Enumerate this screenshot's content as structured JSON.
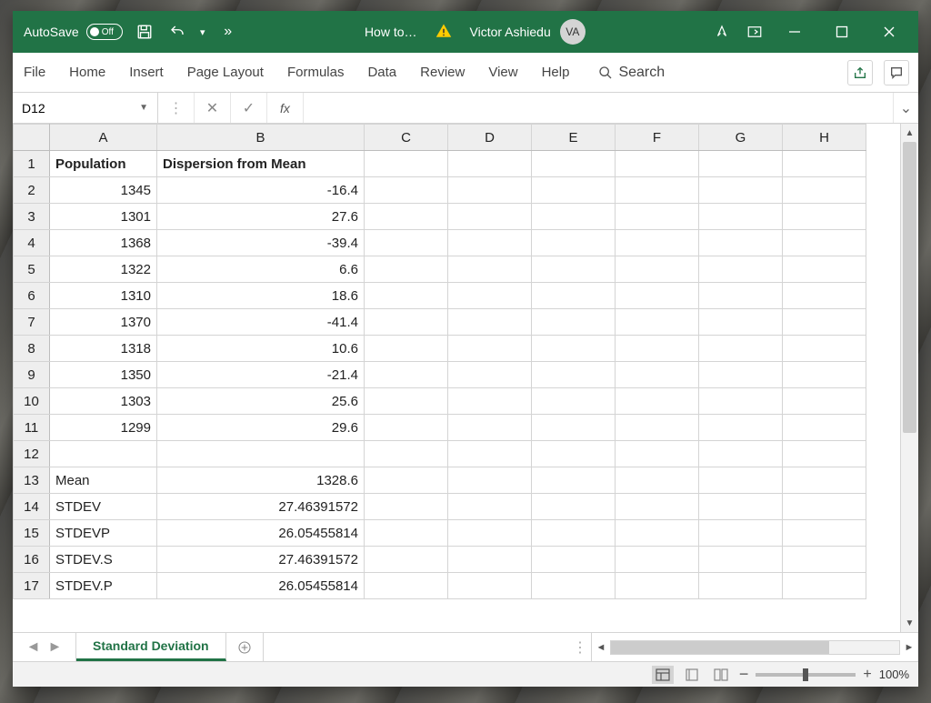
{
  "titlebar": {
    "autosave_label": "AutoSave",
    "autosave_state": "Off",
    "document_title": "How to…",
    "user_name": "Victor Ashiedu",
    "user_initials": "VA"
  },
  "ribbon": {
    "tabs": [
      "File",
      "Home",
      "Insert",
      "Page Layout",
      "Formulas",
      "Data",
      "Review",
      "View",
      "Help"
    ],
    "search_label": "Search"
  },
  "formula_bar": {
    "name_box": "D12",
    "fx_label": "fx",
    "formula": ""
  },
  "columns": [
    "A",
    "B",
    "C",
    "D",
    "E",
    "F",
    "G",
    "H"
  ],
  "col_widths": [
    "col-A",
    "col-B",
    "col-narrow",
    "col-narrow",
    "col-narrow",
    "col-narrow",
    "col-narrow",
    "col-narrow"
  ],
  "rows": [
    {
      "n": 1,
      "A": "Population",
      "A_align": "txt",
      "A_bold": true,
      "B": "Dispersion from Mean",
      "B_align": "txt",
      "B_bold": true
    },
    {
      "n": 2,
      "A": "1345",
      "A_align": "num",
      "B": "-16.4",
      "B_align": "num"
    },
    {
      "n": 3,
      "A": "1301",
      "A_align": "num",
      "B": "27.6",
      "B_align": "num"
    },
    {
      "n": 4,
      "A": "1368",
      "A_align": "num",
      "B": "-39.4",
      "B_align": "num"
    },
    {
      "n": 5,
      "A": "1322",
      "A_align": "num",
      "B": "6.6",
      "B_align": "num"
    },
    {
      "n": 6,
      "A": "1310",
      "A_align": "num",
      "B": "18.6",
      "B_align": "num"
    },
    {
      "n": 7,
      "A": "1370",
      "A_align": "num",
      "B": "-41.4",
      "B_align": "num"
    },
    {
      "n": 8,
      "A": "1318",
      "A_align": "num",
      "B": "10.6",
      "B_align": "num"
    },
    {
      "n": 9,
      "A": "1350",
      "A_align": "num",
      "B": "-21.4",
      "B_align": "num"
    },
    {
      "n": 10,
      "A": "1303",
      "A_align": "num",
      "B": "25.6",
      "B_align": "num"
    },
    {
      "n": 11,
      "A": "1299",
      "A_align": "num",
      "B": "29.6",
      "B_align": "num"
    },
    {
      "n": 12,
      "A": "",
      "B": ""
    },
    {
      "n": 13,
      "A": "Mean",
      "A_align": "txt",
      "B": "1328.6",
      "B_align": "num"
    },
    {
      "n": 14,
      "A": "STDEV",
      "A_align": "txt",
      "B": "27.46391572",
      "B_align": "num"
    },
    {
      "n": 15,
      "A": "STDEVP",
      "A_align": "txt",
      "B": "26.05455814",
      "B_align": "num"
    },
    {
      "n": 16,
      "A": "STDEV.S",
      "A_align": "txt",
      "B": "27.46391572",
      "B_align": "num"
    },
    {
      "n": 17,
      "A": "STDEV.P",
      "A_align": "txt",
      "B": "26.05455814",
      "B_align": "num"
    }
  ],
  "sheet": {
    "active_tab": "Standard Deviation"
  },
  "statusbar": {
    "zoom": "100%"
  }
}
